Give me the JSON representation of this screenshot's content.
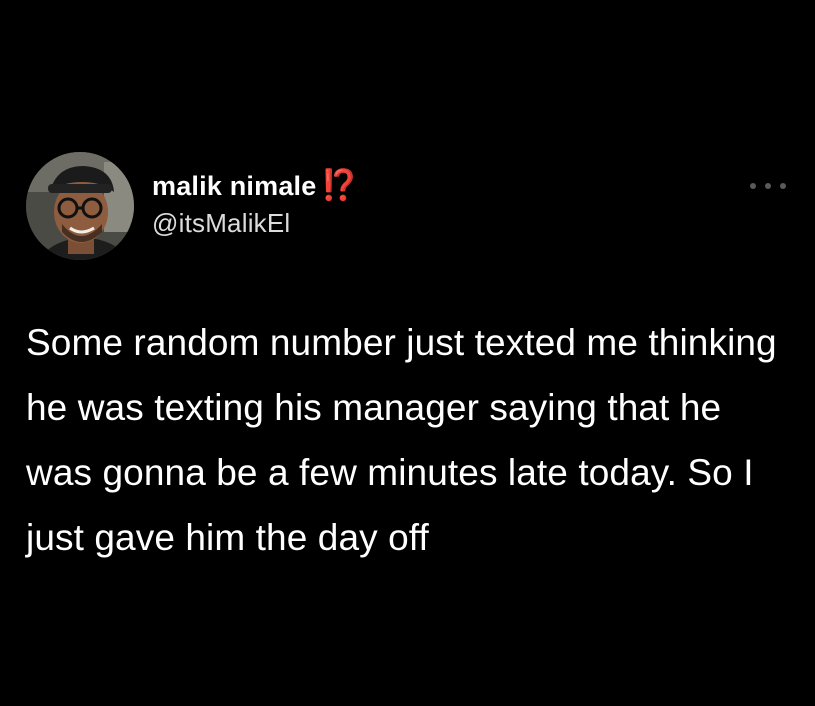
{
  "tweet": {
    "author": {
      "display_name": "malik nimale",
      "name_emoji": "⁉️",
      "handle": "@itsMalikEl"
    },
    "avatar_icon": "profile-photo",
    "more_icon": "more-horizontal-icon",
    "text": "Some random number just texted me thinking he was texting his manager saying that he was gonna be a few minutes late today. So I just gave him the day off"
  },
  "colors": {
    "background": "#000000",
    "text": "#ffffff",
    "handle": "#dcdcdc",
    "emoji": "#e8322e",
    "more_dots": "#5a5a5a"
  }
}
